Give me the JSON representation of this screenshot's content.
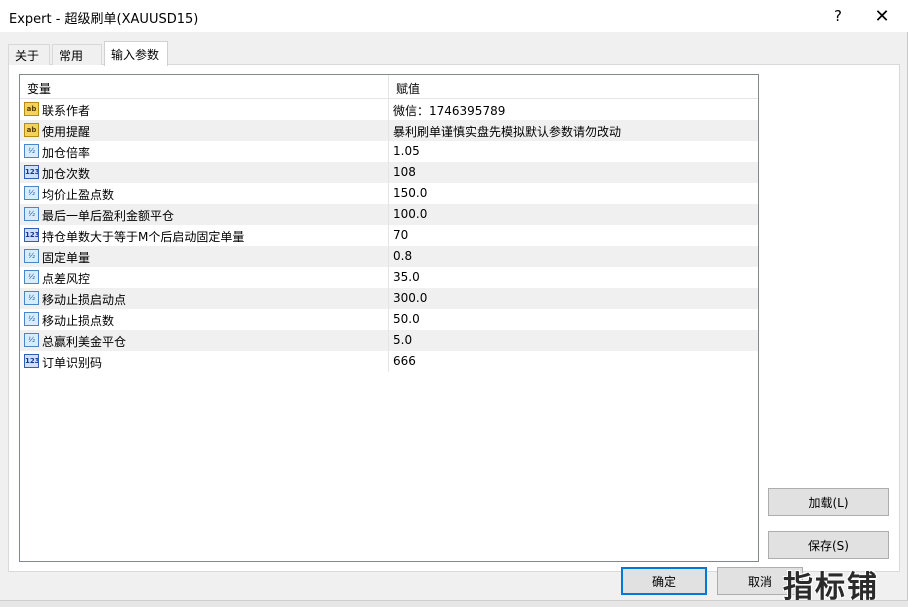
{
  "window": {
    "title": "Expert - 超级刷单(XAUUSD15)",
    "help_glyph": "?",
    "close_glyph": "✕"
  },
  "tabs": [
    {
      "label": "关于"
    },
    {
      "label": "常用"
    },
    {
      "label": "输入参数",
      "active": true
    }
  ],
  "grid": {
    "headers": {
      "variable": "变量",
      "value": "赋值"
    },
    "rows": [
      {
        "type": "ab",
        "icon": "string-type-icon",
        "name": "联系作者",
        "value": "微信：1746395789"
      },
      {
        "type": "ab",
        "icon": "string-type-icon",
        "name": "使用提醒",
        "value": "暴利刷单谨慎实盘先模拟默认参数请勿改动"
      },
      {
        "type": "dbl",
        "icon": "double-type-icon",
        "name": "加仓倍率",
        "value": "1.05"
      },
      {
        "type": "int",
        "icon": "integer-type-icon",
        "name": "加仓次数",
        "value": "108"
      },
      {
        "type": "dbl",
        "icon": "double-type-icon",
        "name": "均价止盈点数",
        "value": "150.0"
      },
      {
        "type": "dbl",
        "icon": "double-type-icon",
        "name": "最后一单后盈利金额平仓",
        "value": "100.0"
      },
      {
        "type": "int",
        "icon": "integer-type-icon",
        "name": "持仓单数大于等于M个后启动固定单量",
        "value": "70"
      },
      {
        "type": "dbl",
        "icon": "double-type-icon",
        "name": "固定单量",
        "value": "0.8"
      },
      {
        "type": "dbl",
        "icon": "double-type-icon",
        "name": "点差风控",
        "value": "35.0"
      },
      {
        "type": "dbl",
        "icon": "double-type-icon",
        "name": "移动止损启动点",
        "value": "300.0"
      },
      {
        "type": "dbl",
        "icon": "double-type-icon",
        "name": "移动止损点数",
        "value": "50.0"
      },
      {
        "type": "dbl",
        "icon": "double-type-icon",
        "name": "总赢利美金平仓",
        "value": "5.0"
      },
      {
        "type": "int",
        "icon": "integer-type-icon",
        "name": "订单识别码",
        "value": "666"
      }
    ]
  },
  "buttons": {
    "load": "加载(L)",
    "save": "保存(S)",
    "ok": "确定",
    "cancel": "取消"
  },
  "watermark": "指标铺",
  "colors": {
    "accent": "#0078d7",
    "row_alt": "#f0f0f0",
    "string_icon": "#f5d25a",
    "number_icon": "#d6ecff"
  }
}
